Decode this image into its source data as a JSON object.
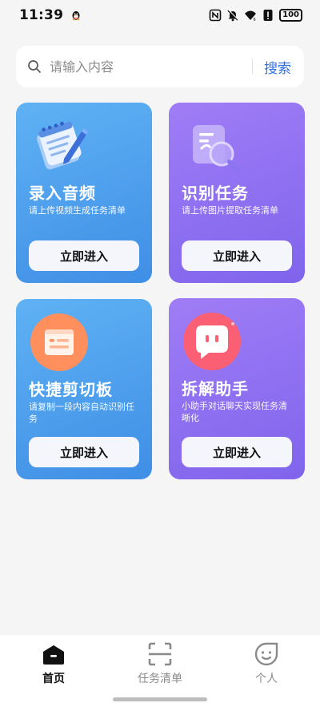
{
  "status_bar": {
    "time": "11:39",
    "battery": "100",
    "icons": [
      "penguin-notification-icon",
      "nfc-icon",
      "mute-icon",
      "wifi-icon",
      "alert-icon",
      "battery-icon"
    ]
  },
  "search": {
    "placeholder": "请输入内容",
    "value": "",
    "button_label": "搜索"
  },
  "cards": [
    {
      "title": "录入音频",
      "description": "请上传视频生成任务清单",
      "button_label": "立即进入",
      "icon": "notepad-pen-icon"
    },
    {
      "title": "识别任务",
      "description": "请上传图片提取任务清单",
      "button_label": "立即进入",
      "icon": "magnifier-document-icon"
    },
    {
      "title": "快捷剪切板",
      "description": "请复制一段内容自动识别任务",
      "button_label": "立即进入",
      "icon": "clipboard-icon"
    },
    {
      "title": "拆解助手",
      "description": "小助手对话聊天实现任务清晰化",
      "button_label": "立即进入",
      "icon": "chat-bubble-icon"
    }
  ],
  "bottom_nav": [
    {
      "label": "首页",
      "icon": "home-icon",
      "active": true
    },
    {
      "label": "任务清单",
      "icon": "scan-icon",
      "active": false
    },
    {
      "label": "个人",
      "icon": "profile-face-icon",
      "active": false
    }
  ],
  "colors": {
    "accent": "#2f6fe0",
    "card_blue": "#4f9eee",
    "card_purple": "#8c6ff0",
    "background": "#f5f5f6"
  }
}
